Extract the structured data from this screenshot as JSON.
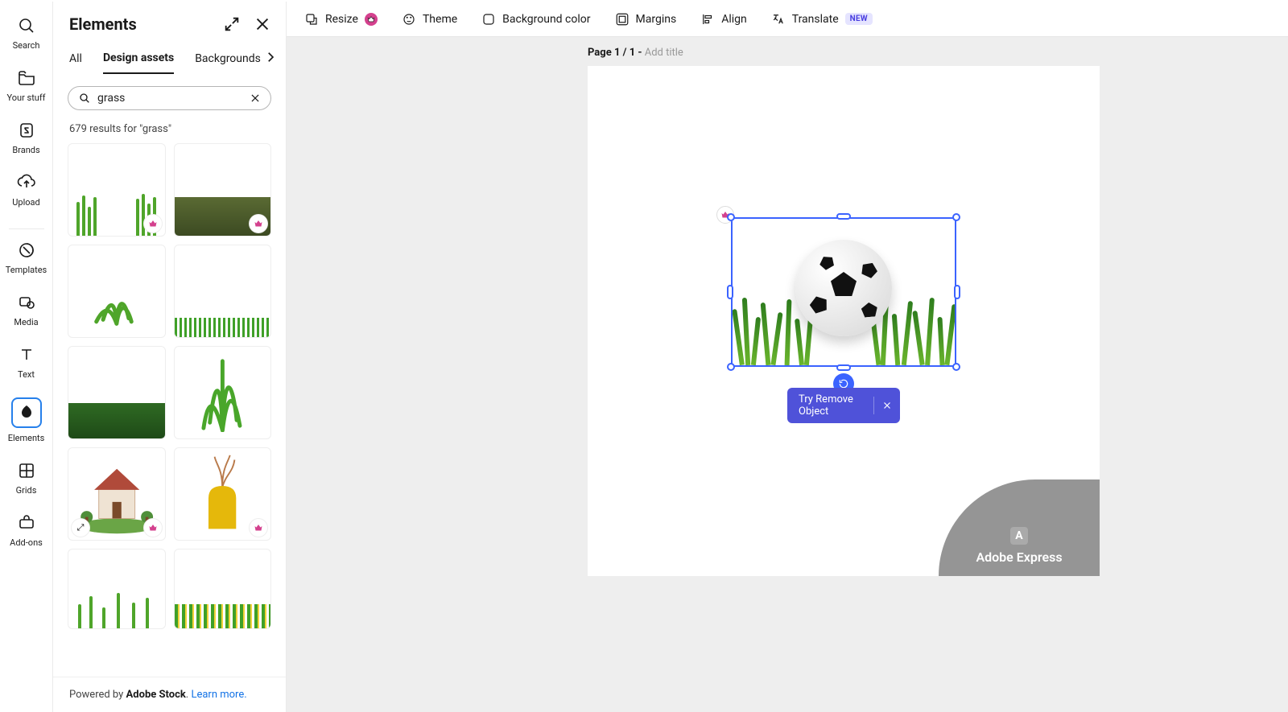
{
  "rail": {
    "search": "Search",
    "your_stuff": "Your stuff",
    "brands": "Brands",
    "upload": "Upload",
    "templates": "Templates",
    "media": "Media",
    "text": "Text",
    "elements": "Elements",
    "grids": "Grids",
    "addons": "Add-ons"
  },
  "panel": {
    "title": "Elements",
    "tabs": {
      "all": "All",
      "design_assets": "Design assets",
      "backgrounds": "Backgrounds"
    },
    "search_value": "grass",
    "results_count": "679 results for \"grass\"",
    "footer_prefix": "Powered by ",
    "footer_brand": "Adobe Stock",
    "footer_sep": ". ",
    "footer_link": "Learn more."
  },
  "toolbar": {
    "resize": "Resize",
    "theme": "Theme",
    "bgcolor": "Background color",
    "margins": "Margins",
    "align": "Align",
    "translate": "Translate",
    "new_badge": "NEW"
  },
  "canvas": {
    "page_label_strong": "Page 1 / 1 - ",
    "page_label_muted": "Add title",
    "try_remove": "Try Remove Object"
  },
  "watermark": {
    "text": "Adobe Express",
    "logo": "A"
  }
}
